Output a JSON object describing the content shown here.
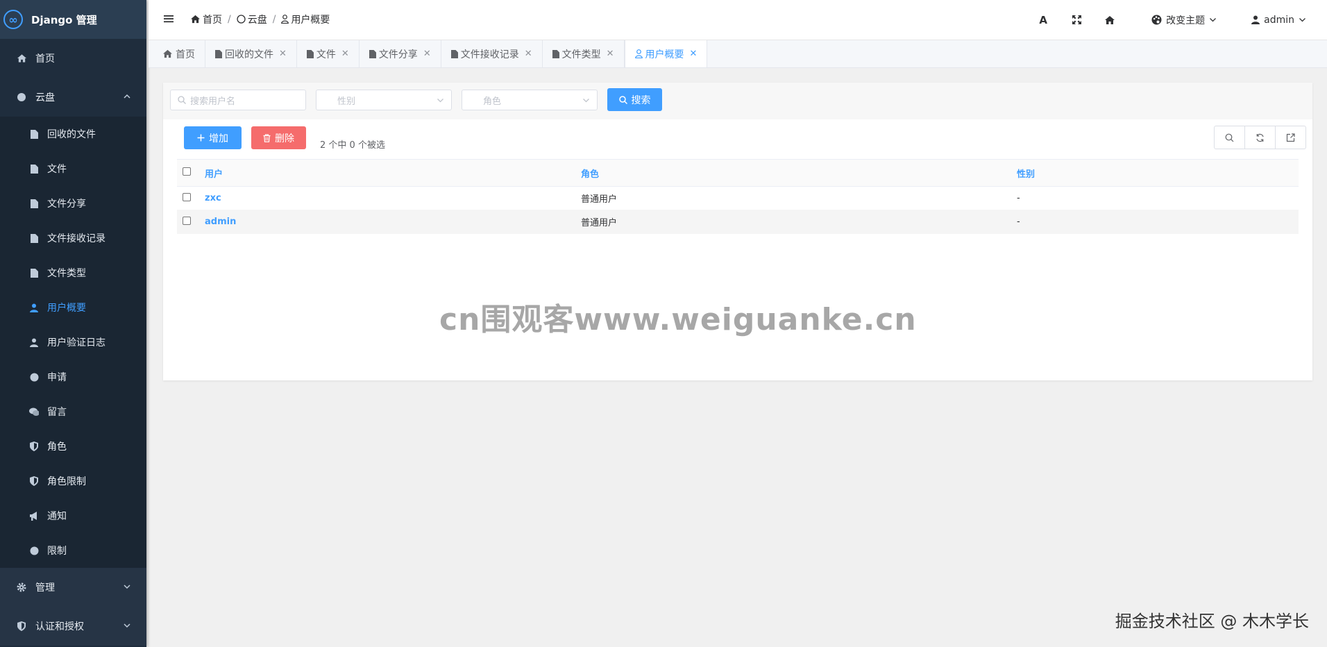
{
  "brand": {
    "title": "Django 管理",
    "logo_glyph": "∞"
  },
  "sidebar": {
    "home": {
      "label": "首页",
      "icon": "home-icon"
    },
    "cloud": {
      "label": "云盘",
      "items": [
        {
          "label": "回收的文件",
          "icon": "file-icon"
        },
        {
          "label": "文件",
          "icon": "file-icon"
        },
        {
          "label": "文件分享",
          "icon": "file-icon"
        },
        {
          "label": "文件接收记录",
          "icon": "file-icon"
        },
        {
          "label": "文件类型",
          "icon": "file-icon"
        },
        {
          "label": "用户概要",
          "icon": "user-icon",
          "active": true
        },
        {
          "label": "用户验证日志",
          "icon": "user-icon"
        },
        {
          "label": "申请",
          "icon": "circle-icon"
        },
        {
          "label": "留言",
          "icon": "comments-icon"
        },
        {
          "label": "角色",
          "icon": "shield-icon"
        },
        {
          "label": "角色限制",
          "icon": "shield-icon"
        },
        {
          "label": "通知",
          "icon": "bullhorn-icon"
        },
        {
          "label": "限制",
          "icon": "circle-icon"
        }
      ]
    },
    "manage": {
      "label": "管理"
    },
    "auth": {
      "label": "认证和授权"
    }
  },
  "header": {
    "breadcrumb": [
      "首页",
      "云盘",
      "用户概要"
    ],
    "theme_label": "改变主题",
    "user_label": "admin",
    "font_glyph": "A"
  },
  "tabs": [
    {
      "label": "首页",
      "closable": false
    },
    {
      "label": "回收的文件",
      "closable": true
    },
    {
      "label": "文件",
      "closable": true
    },
    {
      "label": "文件分享",
      "closable": true
    },
    {
      "label": "文件接收记录",
      "closable": true
    },
    {
      "label": "文件类型",
      "closable": true
    },
    {
      "label": "用户概要",
      "closable": true,
      "active": true
    }
  ],
  "tab_close_glyph": "✕",
  "filters": {
    "search_placeholder": "搜索用户名",
    "gender_placeholder": "性别",
    "role_placeholder": "角色",
    "search_button": "搜索"
  },
  "actions": {
    "add_label": "增加",
    "delete_label": "删除",
    "selection_info": "2 个中 0 个被选"
  },
  "table": {
    "columns": [
      "用户",
      "角色",
      "性别"
    ],
    "rows": [
      {
        "user": "zxc",
        "role": "普通用户",
        "gender": "-"
      },
      {
        "user": "admin",
        "role": "普通用户",
        "gender": "-"
      }
    ]
  },
  "watermark": "cn围观客www.weiguanke.cn",
  "corner_credit": "掘金技术社区 @ 木木学长",
  "colors": {
    "accent": "#409eff",
    "danger": "#f56c6c",
    "sidebar": "#1f2d3d"
  }
}
